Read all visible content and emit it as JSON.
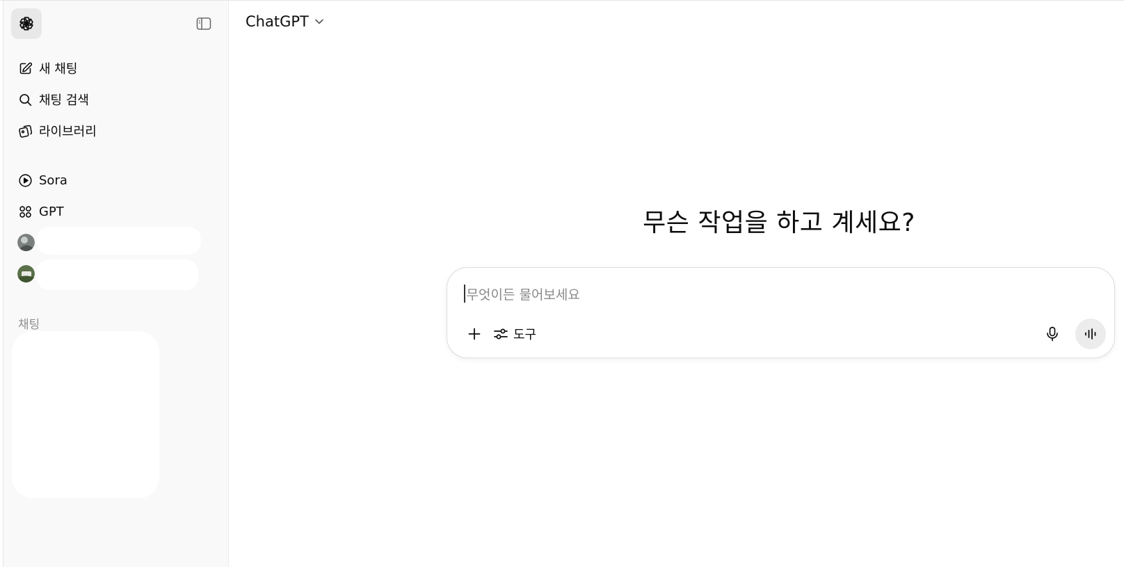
{
  "app": {
    "model_name": "ChatGPT"
  },
  "sidebar": {
    "items": [
      {
        "label": "새 채팅",
        "icon": "new-chat-icon"
      },
      {
        "label": "채팅 검색",
        "icon": "search-icon"
      },
      {
        "label": "라이브러리",
        "icon": "library-icon"
      },
      {
        "label": "Sora",
        "icon": "play-circle-icon"
      },
      {
        "label": "GPT",
        "icon": "grid-icon"
      }
    ],
    "chats_section_label": "채팅"
  },
  "main": {
    "heading": "무슨 작업을 하고 계세요?",
    "composer": {
      "placeholder": "무엇이든 물어보세요",
      "tools_label": "도구"
    }
  },
  "colors": {
    "sidebar_bg": "#f9f9f9",
    "accent_bg": "#ececec",
    "text": "#0d0d0d",
    "muted": "#8f8f8f"
  }
}
